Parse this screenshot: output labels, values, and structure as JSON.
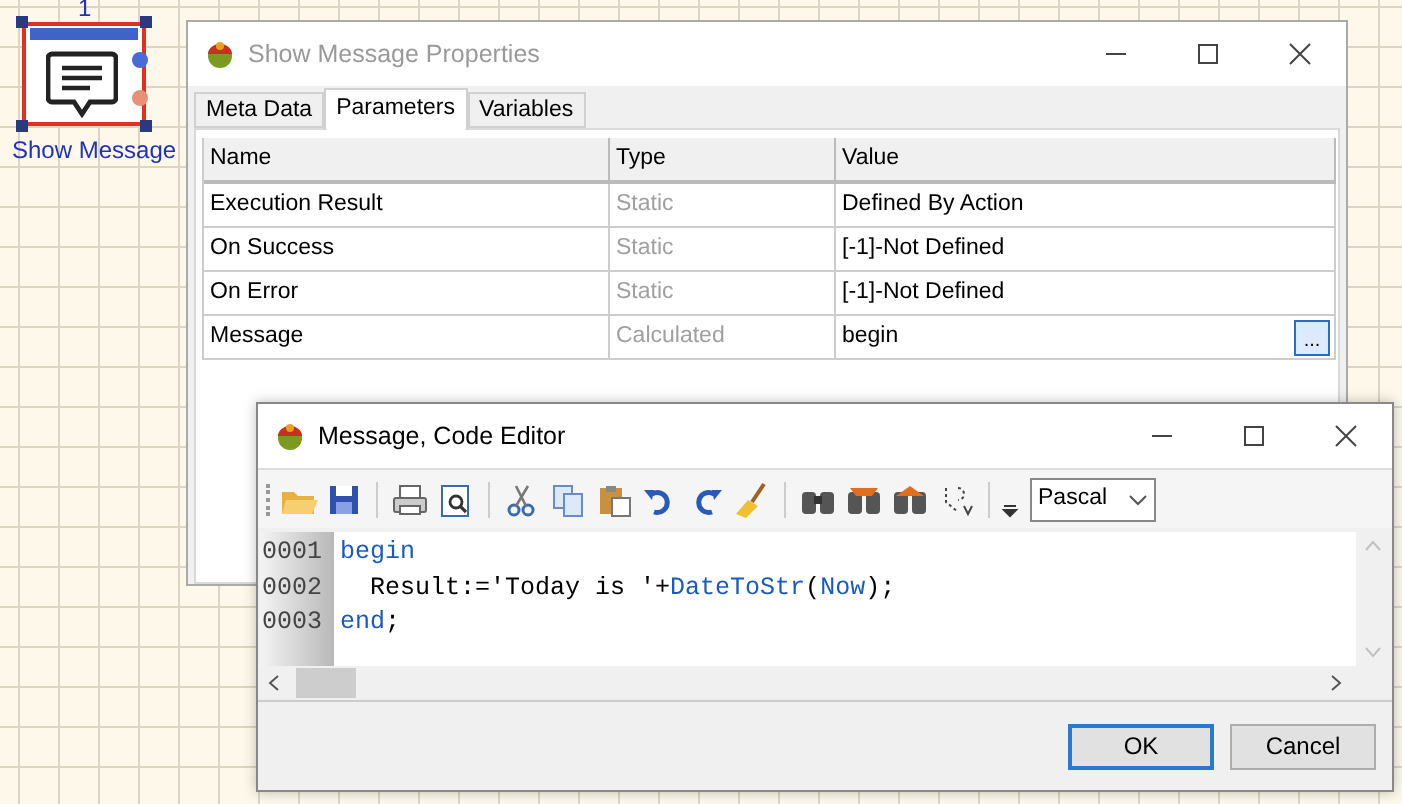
{
  "canvas": {
    "node": {
      "number": "1",
      "label": "Show Message",
      "selected": true
    }
  },
  "properties_window": {
    "title": "Show Message Properties",
    "tabs": [
      {
        "label": "Meta Data",
        "selected": false
      },
      {
        "label": "Parameters",
        "selected": true
      },
      {
        "label": "Variables",
        "selected": false
      }
    ],
    "table": {
      "columns": [
        "Name",
        "Type",
        "Value"
      ],
      "rows": [
        {
          "name": "Execution Result",
          "type": "Static",
          "value": "Defined By Action",
          "editable": false
        },
        {
          "name": "On Success",
          "type": "Static",
          "value": "[-1]-Not Defined",
          "editable": false
        },
        {
          "name": "On Error",
          "type": "Static",
          "value": "[-1]-Not Defined",
          "editable": false
        },
        {
          "name": "Message",
          "type": "Calculated",
          "value": "begin",
          "editable": true,
          "button": "..."
        }
      ]
    }
  },
  "code_editor": {
    "title": "Message, Code Editor",
    "language": "Pascal",
    "lines": [
      {
        "number": "0001",
        "segments": [
          {
            "text": "begin",
            "kind": "keyword"
          }
        ]
      },
      {
        "number": "0002",
        "segments": [
          {
            "text": "  Result:='Today is '+",
            "kind": "plain"
          },
          {
            "text": "DateToStr",
            "kind": "keyword"
          },
          {
            "text": "(",
            "kind": "plain"
          },
          {
            "text": "Now",
            "kind": "keyword"
          },
          {
            "text": ");",
            "kind": "plain"
          }
        ]
      },
      {
        "number": "0003",
        "segments": [
          {
            "text": "end",
            "kind": "keyword"
          },
          {
            "text": ";",
            "kind": "plain"
          }
        ]
      }
    ],
    "buttons": [
      {
        "label": "OK",
        "default": true
      },
      {
        "label": "Cancel",
        "default": false
      }
    ]
  }
}
